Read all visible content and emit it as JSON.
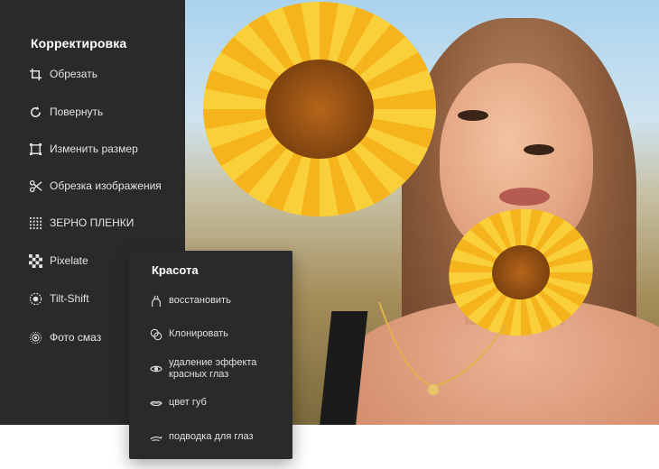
{
  "adjust_panel": {
    "title": "Корректировка",
    "items": [
      {
        "label": "Обрезать",
        "icon": "crop-icon"
      },
      {
        "label": "Повернуть",
        "icon": "rotate-icon"
      },
      {
        "label": "Изменить размер",
        "icon": "resize-icon"
      },
      {
        "label": "Обрезка изображения",
        "icon": "scissors-icon"
      },
      {
        "label": "ЗЕРНО ПЛЕНКИ",
        "icon": "grain-icon"
      },
      {
        "label": "Pixelate",
        "icon": "pixelate-icon"
      },
      {
        "label": "Tilt-Shift",
        "icon": "tilt-shift-icon"
      },
      {
        "label": "Фото смаз",
        "icon": "blur-icon"
      }
    ]
  },
  "beauty_panel": {
    "title": "Красота",
    "items": [
      {
        "label": "восстановить",
        "icon": "heal-icon"
      },
      {
        "label": "Клонировать",
        "icon": "clone-icon"
      },
      {
        "label": "удаление эффекта красных глаз",
        "icon": "eye-icon"
      },
      {
        "label": "цвет губ",
        "icon": "lips-icon"
      },
      {
        "label": "подводка для глаз",
        "icon": "eyeliner-icon"
      }
    ]
  },
  "colors": {
    "panel_bg": "#2a2a2a",
    "text": "#e4e4e4",
    "title": "#ffffff"
  }
}
